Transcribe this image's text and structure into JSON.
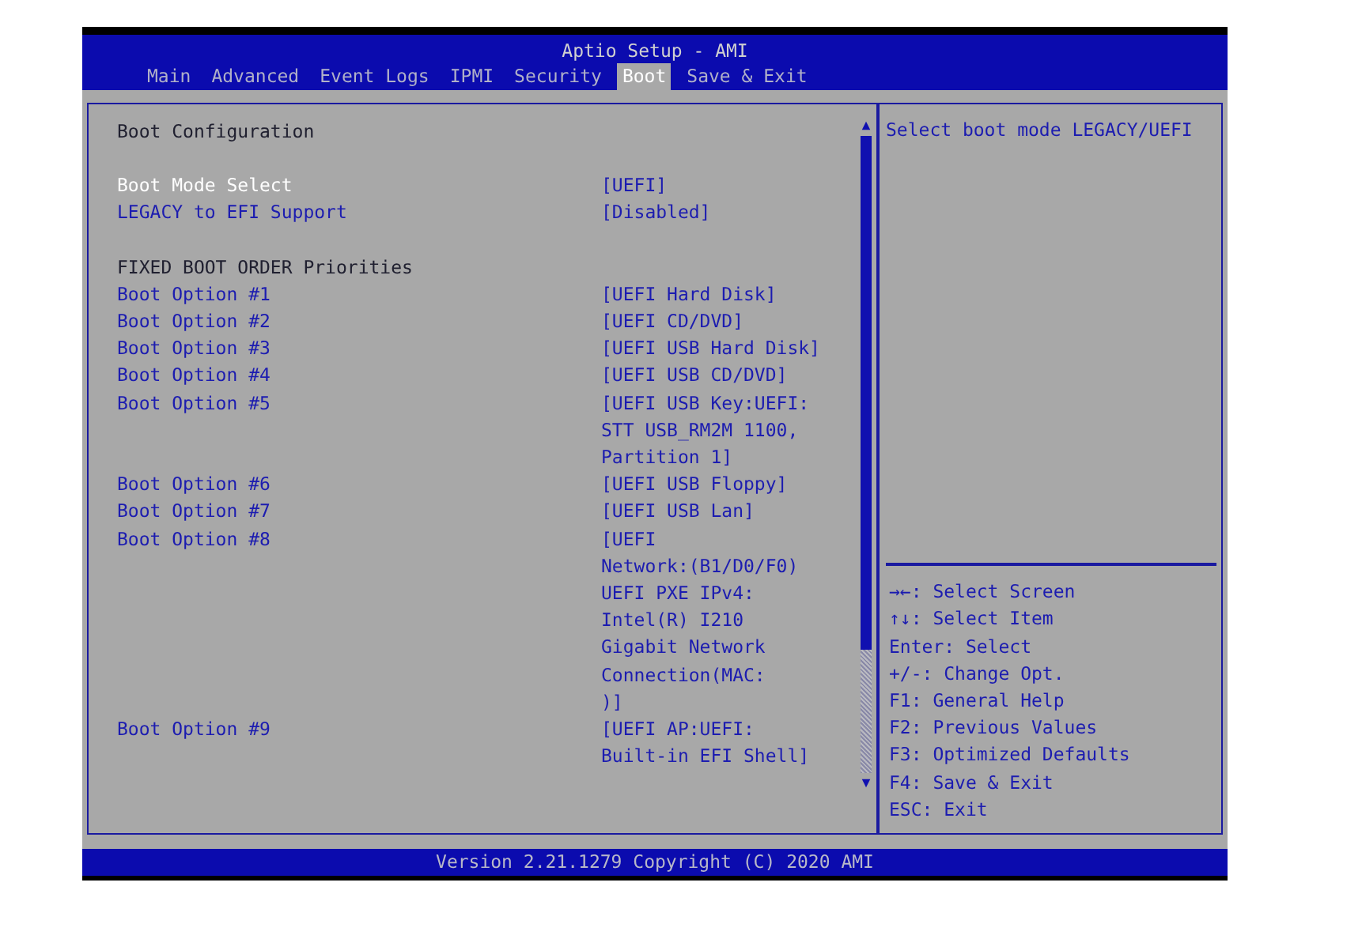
{
  "window": {
    "title": "Aptio Setup - AMI"
  },
  "tabs": [
    {
      "label": "Main",
      "selected": false
    },
    {
      "label": "Advanced",
      "selected": false
    },
    {
      "label": "Event Logs",
      "selected": false
    },
    {
      "label": "IPMI",
      "selected": false
    },
    {
      "label": "Security",
      "selected": false
    },
    {
      "label": "Boot",
      "selected": true
    },
    {
      "label": "Save & Exit",
      "selected": false
    }
  ],
  "heading": "Boot Configuration",
  "settings": [
    {
      "label": "Boot Mode Select",
      "value": "[UEFI]",
      "selected": true
    },
    {
      "label": "LEGACY to EFI Support",
      "value": "[Disabled]",
      "selected": false
    }
  ],
  "priorities": {
    "title": "FIXED BOOT ORDER Priorities",
    "options": [
      {
        "label": "Boot Option #1",
        "value": "[UEFI Hard Disk]",
        "selected": false
      },
      {
        "label": "Boot Option #2",
        "value": "[UEFI CD/DVD]",
        "selected": false
      },
      {
        "label": "Boot Option #3",
        "value": "[UEFI USB Hard Disk]",
        "selected": false
      },
      {
        "label": "Boot Option #4",
        "value": "[UEFI USB CD/DVD]",
        "selected": false
      },
      {
        "label": "Boot Option #5",
        "value": "[UEFI USB Key:UEFI:\nSTT USB_RM2M 1100,\nPartition 1]",
        "selected": false
      },
      {
        "label": "Boot Option #6",
        "value": "[UEFI USB Floppy]",
        "selected": false
      },
      {
        "label": "Boot Option #7",
        "value": "[UEFI USB Lan]",
        "selected": false
      },
      {
        "label": "Boot Option #8",
        "value": "[UEFI\nNetwork:(B1/D0/F0)\nUEFI PXE IPv4:\nIntel(R) I210\nGigabit  Network\nConnection(MAC:\n)]",
        "selected": false
      },
      {
        "label": "Boot Option #9",
        "value": "[UEFI AP:UEFI:\nBuilt-in EFI Shell]",
        "selected": false
      }
    ]
  },
  "help_text": "Select boot mode LEGACY/UEFI",
  "keys": [
    "→←: Select Screen",
    "↑↓: Select Item",
    "Enter: Select",
    "+/-: Change Opt.",
    "F1: General Help",
    "F2: Previous Values",
    "F3: Optimized Defaults",
    "F4: Save & Exit",
    "ESC: Exit"
  ],
  "status_bar": "Version 2.21.1279 Copyright (C) 2020 AMI"
}
